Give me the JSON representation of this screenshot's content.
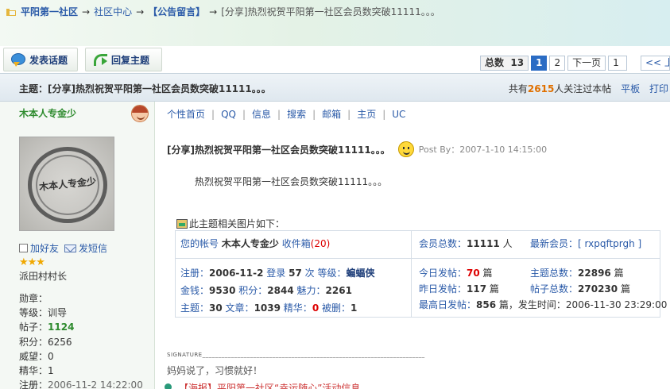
{
  "breadcrumb": {
    "home": "平阳第一社区",
    "center": "社区中心",
    "board": "【公告留言】",
    "current": "[分享]热烈祝贺平阳第一社区会员数突破11111。。。",
    "arrow": "→"
  },
  "actions": {
    "new_topic": "发表话题",
    "reply": "回复主题"
  },
  "pager": {
    "total_label": "总数",
    "total": "13",
    "page1": "1",
    "page2": "2",
    "next": "下一页",
    "jump_value": "1",
    "prev": "<< 上一"
  },
  "topic": {
    "title": "主题：[分享]热烈祝贺平阳第一社区会员数突破11111。。。",
    "watch_prefix": "共有",
    "watch_count": "2615",
    "watch_suffix": "人关注过本帖",
    "flat": "平板",
    "print": "打印"
  },
  "user": {
    "name": "木本人专金少",
    "stamp_text": "木本人专金少",
    "add_friend": "加好友",
    "message": "发短信",
    "stars": "★★★",
    "rank": "派田村村长",
    "stats": [
      {
        "label": "勋章：",
        "value": ""
      },
      {
        "label": "等级：",
        "value": "训导"
      },
      {
        "label": "帖子：",
        "value": "1124"
      },
      {
        "label": "积分：",
        "value": "6256"
      },
      {
        "label": "威望：",
        "value": "0"
      },
      {
        "label": "精华：",
        "value": "1"
      },
      {
        "label": "注册：",
        "value": "2006-11-2 14:22:00"
      }
    ]
  },
  "navlinks": [
    "个性首页",
    "QQ",
    "信息",
    "搜索",
    "邮箱",
    "主页",
    "UC"
  ],
  "post": {
    "title": "[分享]热烈祝贺平阳第一社区会员数突破11111。。。",
    "post_by": "Post By：2007-1-10 14:15:00",
    "body": "热烈祝贺平阳第一社区会员数突破11111。。。",
    "images_label": "此主题相关图片如下："
  },
  "infobox": {
    "account_prefix": "您的帐号",
    "account_name": "木本人专金少",
    "inbox_label": "收件箱",
    "inbox_count": "(20)",
    "reg_label": "注册：",
    "reg_date": "2006-11-2",
    "login_label": "登录",
    "login_count": "57",
    "times_label": "次",
    "level_label": "等级：",
    "level": "蝙蝠侠",
    "money_label": "金钱：",
    "money": "9530",
    "score_label": "积分：",
    "score": "2844",
    "charm_label": "魅力：",
    "charm": "2261",
    "topics_label": "主题：",
    "topics": "30",
    "articles_label": "文章：",
    "articles": "1039",
    "essence_label": "精华：",
    "essence": "0",
    "deleted_label": "被删：",
    "deleted": "1",
    "members_label": "会员总数：",
    "members": "11111",
    "members_unit": "人",
    "newest_label": "最新会员：",
    "newest": "[ rxpqftprgh ]",
    "today_label": "今日发帖：",
    "today": "70",
    "today_unit": "篇",
    "total_topics_label": "主题总数：",
    "total_topics": "22896",
    "total_topics_unit": "篇",
    "yesterday_label": "昨日发帖：",
    "yesterday": "117",
    "yesterday_unit": "篇",
    "total_posts_label": "帖子总数：",
    "total_posts": "270230",
    "total_posts_unit": "篇",
    "max_label": "最高日发帖：",
    "max": "856",
    "max_unit": "篇，发生时间：",
    "max_time": "2006-11-30 23:29:00"
  },
  "signature": {
    "label": "SIGNATURE______________________________________________________________________",
    "text": "妈妈说了，习惯就好！"
  },
  "bottom": {
    "text": "【海报】平阳第一社区“幸运随心”活动信息"
  },
  "colors": {
    "brand_blue": "#2a5aa8",
    "user_green": "#2e8b2e",
    "highlight_orange": "#e07000",
    "highlight_red": "#d00",
    "pager_current": "#2b6cc4"
  }
}
